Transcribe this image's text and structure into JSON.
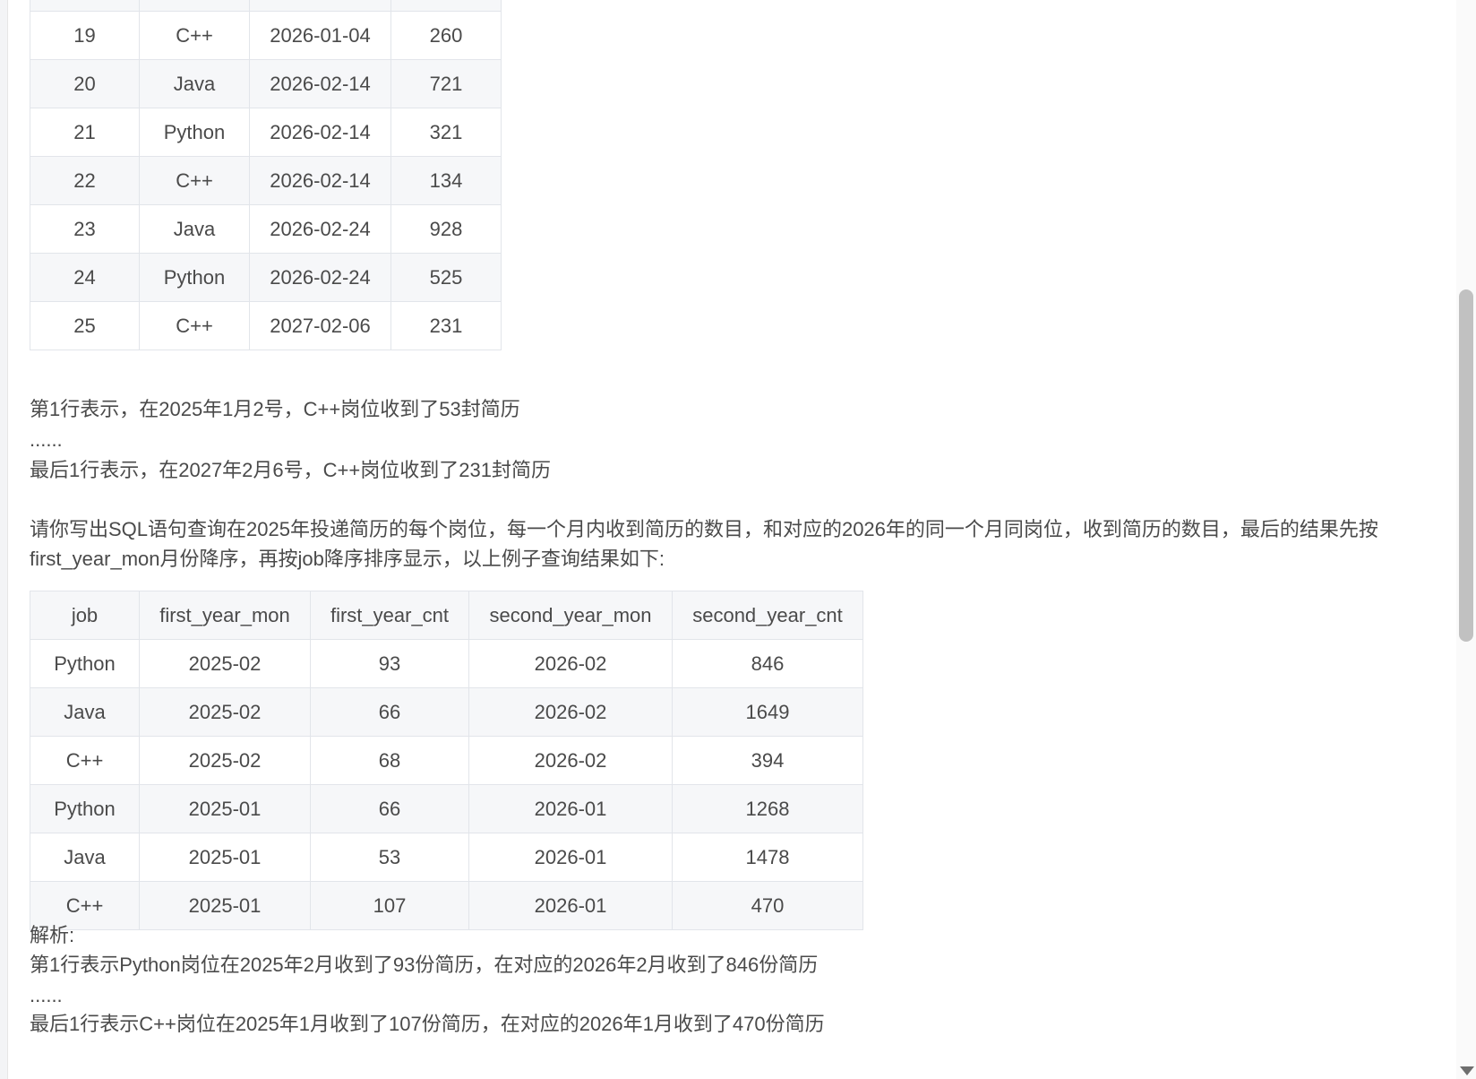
{
  "top_table": {
    "rows": [
      [
        "",
        "",
        "",
        ""
      ],
      [
        "19",
        "C++",
        "2026-01-04",
        "260"
      ],
      [
        "20",
        "Java",
        "2026-02-14",
        "721"
      ],
      [
        "21",
        "Python",
        "2026-02-14",
        "321"
      ],
      [
        "22",
        "C++",
        "2026-02-14",
        "134"
      ],
      [
        "23",
        "Java",
        "2026-02-24",
        "928"
      ],
      [
        "24",
        "Python",
        "2026-02-24",
        "525"
      ],
      [
        "25",
        "C++",
        "2027-02-06",
        "231"
      ]
    ]
  },
  "explain1": {
    "line1": "第1行表示，在2025年1月2号，C++岗位收到了53封简历",
    "ellipsis": "......",
    "line_last": "最后1行表示，在2027年2月6号，C++岗位收到了231封简历"
  },
  "question": "请你写出SQL语句查询在2025年投递简历的每个岗位，每一个月内收到简历的数目，和对应的2026年的同一个月同岗位，收到简历的数目，最后的结果先按first_year_mon月份降序，再按job降序排序显示，以上例子查询结果如下:",
  "result_table": {
    "headers": [
      "job",
      "first_year_mon",
      "first_year_cnt",
      "second_year_mon",
      "second_year_cnt"
    ],
    "rows": [
      [
        "Python",
        "2025-02",
        "93",
        "2026-02",
        "846"
      ],
      [
        "Java",
        "2025-02",
        "66",
        "2026-02",
        "1649"
      ],
      [
        "C++",
        "2025-02",
        "68",
        "2026-02",
        "394"
      ],
      [
        "Python",
        "2025-01",
        "66",
        "2026-01",
        "1268"
      ],
      [
        "Java",
        "2025-01",
        "53",
        "2026-01",
        "1478"
      ],
      [
        "C++",
        "2025-01",
        "107",
        "2026-01",
        "470"
      ]
    ]
  },
  "analysis": {
    "label": "解析:",
    "line1": "第1行表示Python岗位在2025年2月收到了93份简历，在对应的2026年2月收到了846份简历",
    "ellipsis": "......",
    "line_last": "最后1行表示C++岗位在2025年1月收到了107份简历，在对应的2026年1月收到了470份简历"
  }
}
